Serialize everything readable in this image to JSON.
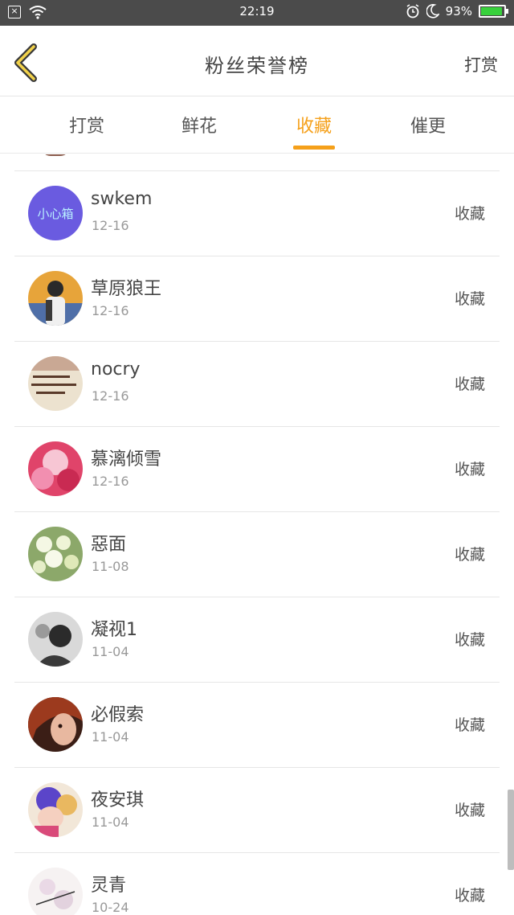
{
  "status_bar": {
    "time": "22:19",
    "battery": "93%",
    "battery_level": 0.93,
    "icons": [
      "close-box-icon",
      "wifi-icon",
      "alarm-icon",
      "moon-icon",
      "battery-icon"
    ]
  },
  "header": {
    "title": "粉丝荣誉榜",
    "action": "打赏",
    "back_icon": "chevron-left-icon"
  },
  "tabs": [
    {
      "label": "打赏",
      "active": false
    },
    {
      "label": "鲜花",
      "active": false
    },
    {
      "label": "收藏",
      "active": true
    },
    {
      "label": "催更",
      "active": false
    }
  ],
  "colors": {
    "accent": "#f5a01a",
    "status_bar_bg": "#4b4b4b",
    "battery_fill": "#38d13c"
  },
  "fans": [
    {
      "name": "swkem",
      "date": "12-16",
      "action": "收藏",
      "avatar_text": "小心箱"
    },
    {
      "name": "草原狼王",
      "date": "12-16",
      "action": "收藏"
    },
    {
      "name": "nocry",
      "date": "12-16",
      "action": "收藏"
    },
    {
      "name": "慕漓倾雪",
      "date": "12-16",
      "action": "收藏"
    },
    {
      "name": "惡面",
      "date": "11-08",
      "action": "收藏"
    },
    {
      "name": "凝视1",
      "date": "11-04",
      "action": "收藏"
    },
    {
      "name": "必假索",
      "date": "11-04",
      "action": "收藏"
    },
    {
      "name": "夜安琪",
      "date": "11-04",
      "action": "收藏"
    },
    {
      "name": "灵青",
      "date": "10-24",
      "action": "收藏"
    }
  ]
}
